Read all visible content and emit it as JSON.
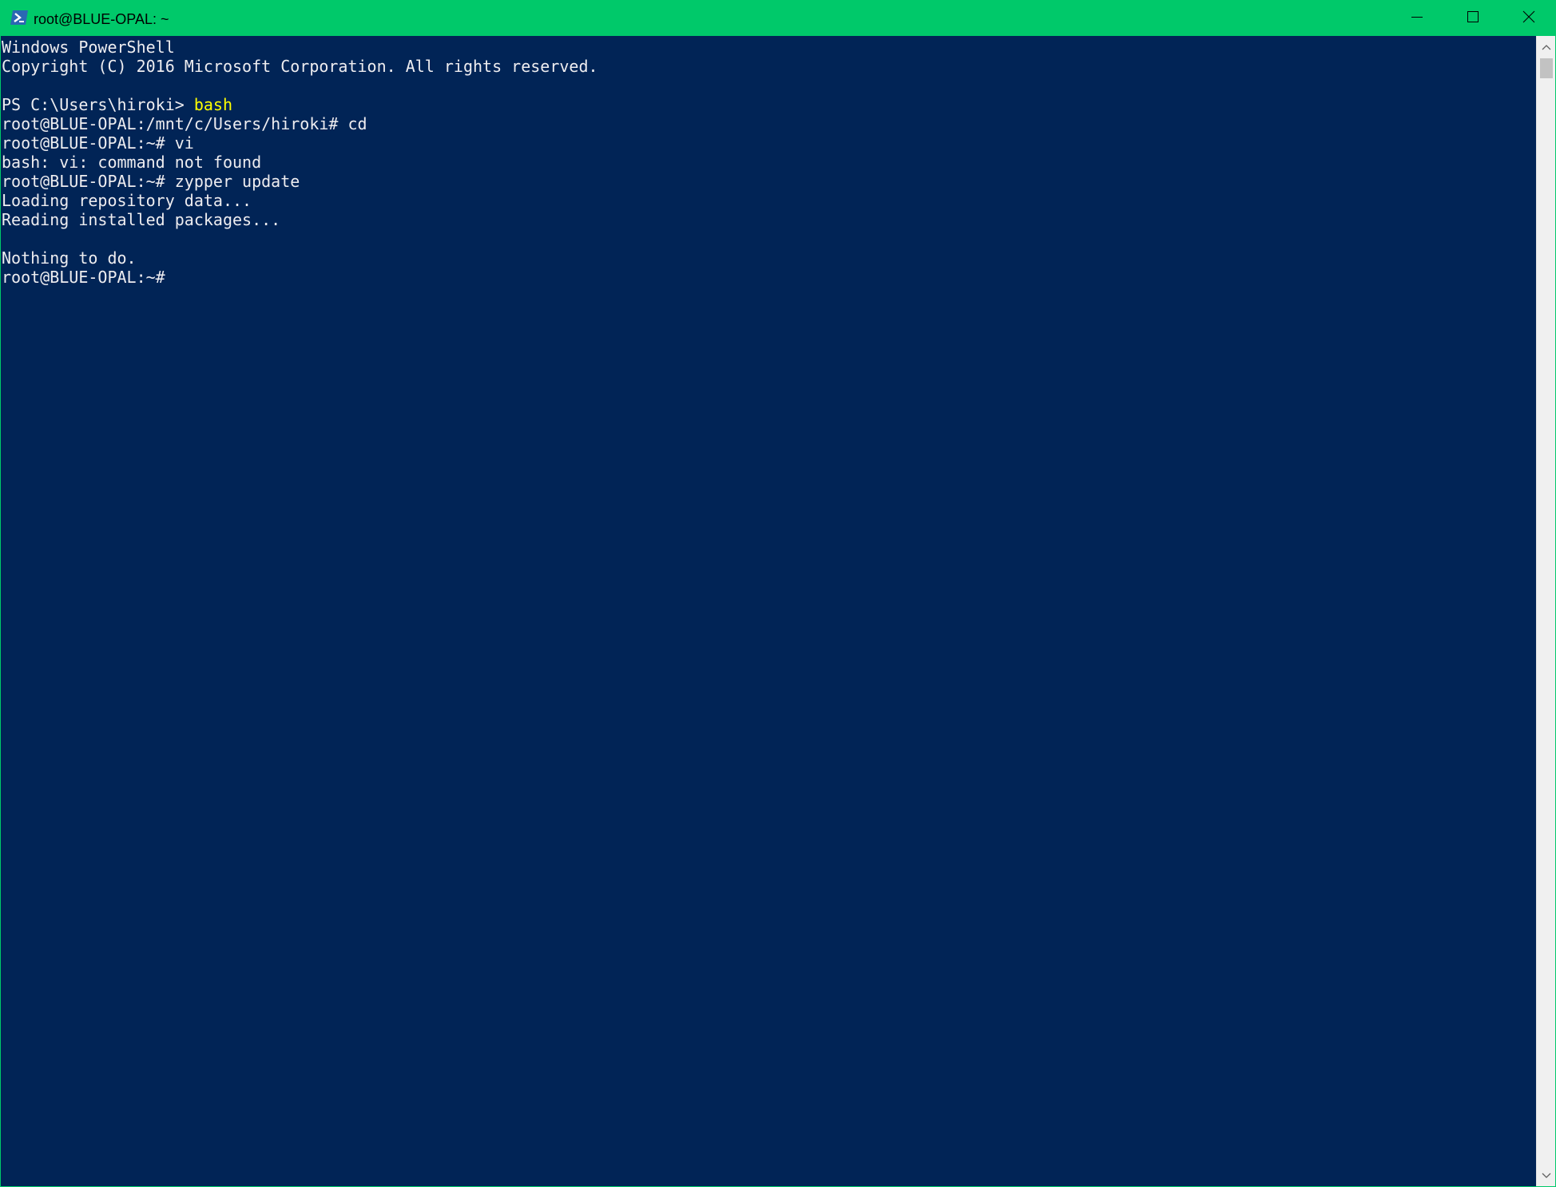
{
  "window": {
    "title": "root@BLUE-OPAL: ~",
    "icon": "powershell-icon",
    "controls": {
      "minimize": "minimize-icon",
      "maximize": "maximize-icon",
      "close": "close-icon"
    },
    "colors": {
      "titlebar": "#00c96a",
      "console_bg": "#012456",
      "console_fg": "#eeedf0",
      "highlight": "#ffff00"
    }
  },
  "console": {
    "lines": [
      "Windows PowerShell",
      "Copyright (C) 2016 Microsoft Corporation. All rights reserved.",
      "",
      {
        "prompt": "PS C:\\Users\\hiroki> ",
        "command": "bash"
      },
      "root@BLUE-OPAL:/mnt/c/Users/hiroki# cd",
      "root@BLUE-OPAL:~# vi",
      "bash: vi: command not found",
      "root@BLUE-OPAL:~# zypper update",
      "Loading repository data...",
      "Reading installed packages...",
      "",
      "Nothing to do.",
      "root@BLUE-OPAL:~#"
    ]
  }
}
